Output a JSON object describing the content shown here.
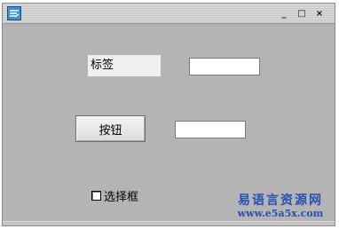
{
  "window": {
    "icon": "app-icon",
    "controls": {
      "minimize": "_",
      "maximize": "□",
      "close": "×"
    }
  },
  "form": {
    "label_text": "标签",
    "edit1_value": "",
    "edit2_value": "",
    "button_label": "按钮",
    "checkbox_label": "选择框",
    "checkbox_checked": false
  },
  "watermark": {
    "title": "易语言资源网",
    "url": "www.e5a5x.com"
  },
  "colors": {
    "window_bg": "#b4b4b4",
    "watermark": "#2a4fb5"
  }
}
